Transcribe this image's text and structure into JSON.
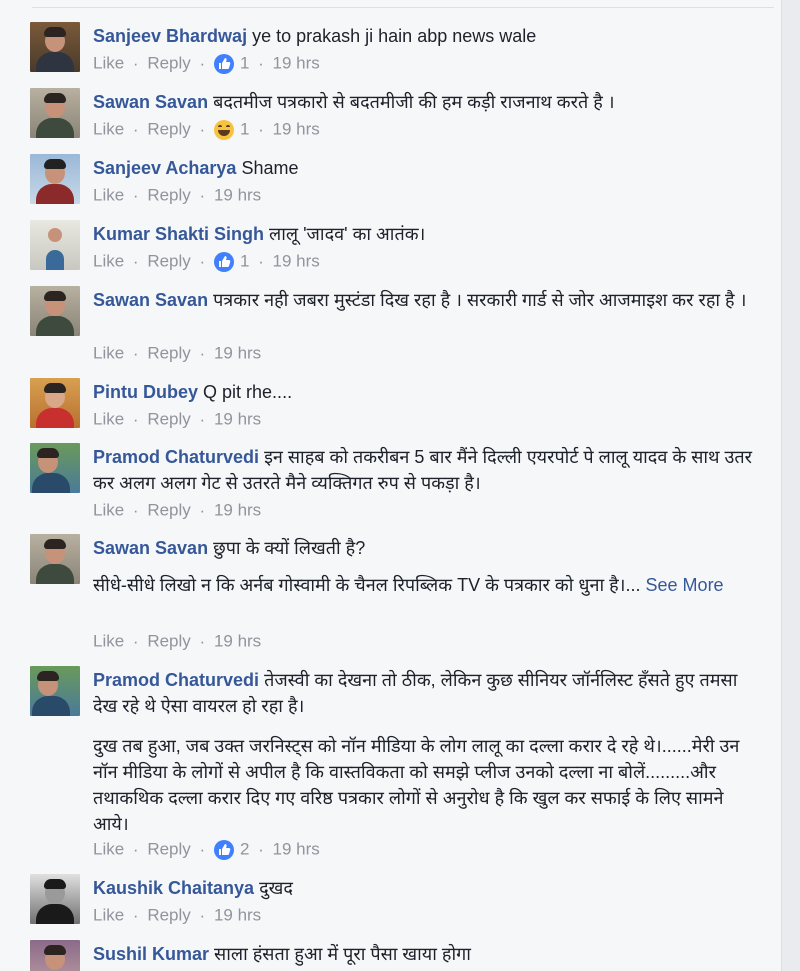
{
  "actions": {
    "like": "Like",
    "reply": "Reply",
    "see_more": "See More",
    "separator": "·"
  },
  "colors": {
    "name": "#365899",
    "meta": "#90949c",
    "text": "#1d2129",
    "like_reaction": "#4080ff",
    "haha_reaction": "#f7c23d"
  },
  "comments": [
    {
      "name": "Sanjeev Bhardwaj",
      "text": "ye to prakash ji hain abp news wale",
      "reaction": "like-icon",
      "reaction_count": "1",
      "time": "19 hrs"
    },
    {
      "name": "Sawan Savan",
      "text": "बदतमीज पत्रकारो से बदतमीजी की हम कड़ी राजनाथ करते है ।",
      "reaction": "haha-icon",
      "reaction_count": "1",
      "time": "19 hrs"
    },
    {
      "name": "Sanjeev Acharya",
      "text": "Shame",
      "time": "19 hrs"
    },
    {
      "name": "Kumar Shakti Singh",
      "text": "लालू 'जादव' का आतंक।",
      "reaction": "like-icon",
      "reaction_count": "1",
      "time": "19 hrs"
    },
    {
      "name": "Sawan Savan",
      "text": "पत्रकार नही जबरा मुस्टंडा दिख रहा है । सरकारी गार्ड से जोर आजमाइश कर रहा है ।",
      "time": "19 hrs"
    },
    {
      "name": "Pintu Dubey",
      "text": "Q pit rhe....",
      "time": "19 hrs"
    },
    {
      "name": "Pramod Chaturvedi",
      "text": "इन साहब को तकरीबन 5 बार मैंने दिल्ली एयरपोर्ट पे लालू यादव के साथ उतर कर अलग अलग गेट से उतरते मैने व्यक्तिगत रुप से पकड़ा है।",
      "time": "19 hrs"
    },
    {
      "name": "Sawan Savan",
      "text": "छुपा के क्यों लिखती है?",
      "text2": "सीधे-सीधे लिखो न कि अर्नब गोस्वामी के चैनल रिपब्लिक TV के पत्रकार को धुना है।...",
      "time": "19 hrs"
    },
    {
      "name": "Pramod Chaturvedi",
      "text": "तेजस्वी का देखना तो ठीक, लेकिन कुछ सीनियर जॉर्नलिस्ट हँसते हुए तमसा देख रहे थे ऐसा वायरल हो रहा है।",
      "text2": "दुख तब हुआ, जब उक्त जरनिस्ट्स को नॉन मीडिया के लोग लालू का दल्ला करार दे रहे थे।......मेरी उन नॉन मीडिया के लोगों से अपील है कि वास्तविकता को समझे प्लीज उनको दल्ला ना बोलें.........और तथाकथिक दल्ला करार दिए गए वरिष्ठ पत्रकार लोगों से अनुरोध है कि खुल कर सफाई के लिए सामने आये।",
      "reaction": "like-icon",
      "reaction_count": "2",
      "time": "19 hrs"
    },
    {
      "name": "Kaushik Chaitanya",
      "text": "दुखद",
      "time": "19 hrs"
    },
    {
      "name": "Sushil Kumar",
      "text": "साला हंसता हुआ में पूरा पैसा खाया होगा"
    }
  ]
}
